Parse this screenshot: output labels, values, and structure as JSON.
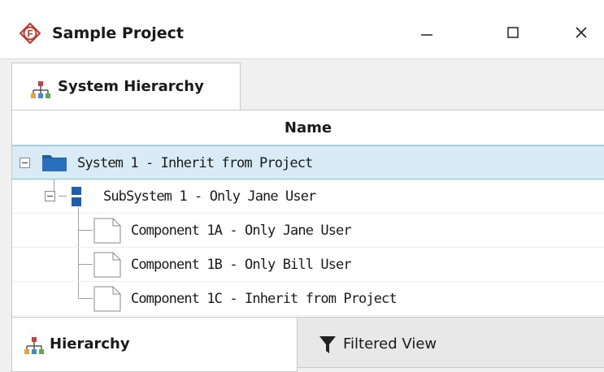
{
  "window": {
    "title": "Sample Project",
    "app_icon": "f-logo-icon",
    "controls": {
      "minimize": "minimize-icon",
      "maximize": "maximize-icon",
      "close": "close-icon"
    }
  },
  "top_tabs": [
    {
      "label": "System Hierarchy",
      "icon": "hierarchy-icon",
      "active": true
    }
  ],
  "tree": {
    "column_header": "Name",
    "rows": [
      {
        "label": "System 1 - Inherit from Project",
        "type": "system",
        "level": 0,
        "selected": true,
        "expanded": true
      },
      {
        "label": "SubSystem 1 - Only Jane User",
        "type": "subsystem",
        "level": 1,
        "selected": false,
        "expanded": true
      },
      {
        "label": "Component 1A - Only Jane User",
        "type": "component",
        "level": 2,
        "selected": false
      },
      {
        "label": "Component 1B - Only Bill User",
        "type": "component",
        "level": 2,
        "selected": false
      },
      {
        "label": "Component 1C - Inherit from Project",
        "type": "component",
        "level": 2,
        "selected": false
      }
    ]
  },
  "bottom_tabs": [
    {
      "label": "Hierarchy",
      "icon": "hierarchy-icon",
      "active": true
    },
    {
      "label": "Filtered View",
      "icon": "filter-icon",
      "active": false
    }
  ],
  "colors": {
    "brand_red": "#c0392b",
    "selection_bg": "#d9ecf6",
    "selection_border": "#7fc3e6",
    "folder_blue": "#1f5fa8"
  }
}
